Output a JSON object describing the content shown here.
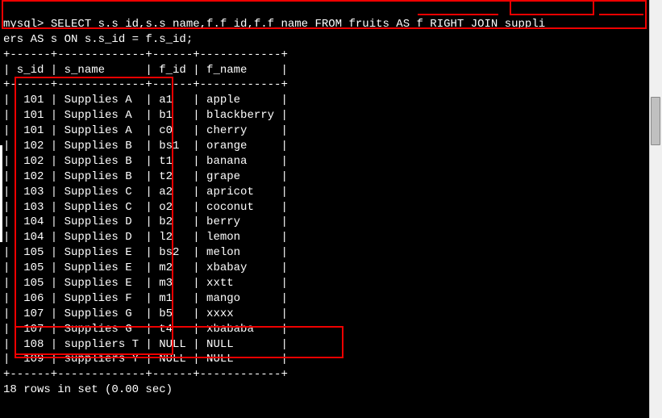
{
  "prompt": "mysql>",
  "query_line1": " SELECT s.s_id,s.s_name,f.f_id,f.f_name FROM fruits AS f RIGHT JOIN suppli",
  "query_line2": "ers AS s ON s.s_id = f.s_id;",
  "separator": "+------+-------------+------+------------+",
  "header": "| s_id | s_name      | f_id | f_name     |",
  "rows": [
    "|  101 | Supplies A  | a1   | apple      |",
    "|  101 | Supplies A  | b1   | blackberry |",
    "|  101 | Supplies A  | c0   | cherry     |",
    "|  102 | Supplies B  | bs1  | orange     |",
    "|  102 | Supplies B  | t1   | banana     |",
    "|  102 | Supplies B  | t2   | grape      |",
    "|  103 | Supplies C  | a2   | apricot    |",
    "|  103 | Supplies C  | o2   | coconut    |",
    "|  104 | Supplies D  | b2   | berry      |",
    "|  104 | Supplies D  | l2   | lemon      |",
    "|  105 | Supplies E  | bs2  | melon      |",
    "|  105 | Supplies E  | m2   | xbabay     |",
    "|  105 | Supplies E  | m3   | xxtt       |",
    "|  106 | Supplies F  | m1   | mango      |",
    "|  107 | Supplies G  | b5   | xxxx       |",
    "|  107 | Supplies G  | t4   | xbababa    |",
    "|  108 | suppliers T | NULL | NULL       |",
    "|  109 | suppliers Y | NULL | NULL       |"
  ],
  "footer": "18 rows in set (0.00 sec)",
  "chart_data": {
    "type": "table",
    "columns": [
      "s_id",
      "s_name",
      "f_id",
      "f_name"
    ],
    "data": [
      {
        "s_id": 101,
        "s_name": "Supplies A",
        "f_id": "a1",
        "f_name": "apple"
      },
      {
        "s_id": 101,
        "s_name": "Supplies A",
        "f_id": "b1",
        "f_name": "blackberry"
      },
      {
        "s_id": 101,
        "s_name": "Supplies A",
        "f_id": "c0",
        "f_name": "cherry"
      },
      {
        "s_id": 102,
        "s_name": "Supplies B",
        "f_id": "bs1",
        "f_name": "orange"
      },
      {
        "s_id": 102,
        "s_name": "Supplies B",
        "f_id": "t1",
        "f_name": "banana"
      },
      {
        "s_id": 102,
        "s_name": "Supplies B",
        "f_id": "t2",
        "f_name": "grape"
      },
      {
        "s_id": 103,
        "s_name": "Supplies C",
        "f_id": "a2",
        "f_name": "apricot"
      },
      {
        "s_id": 103,
        "s_name": "Supplies C",
        "f_id": "o2",
        "f_name": "coconut"
      },
      {
        "s_id": 104,
        "s_name": "Supplies D",
        "f_id": "b2",
        "f_name": "berry"
      },
      {
        "s_id": 104,
        "s_name": "Supplies D",
        "f_id": "l2",
        "f_name": "lemon"
      },
      {
        "s_id": 105,
        "s_name": "Supplies E",
        "f_id": "bs2",
        "f_name": "melon"
      },
      {
        "s_id": 105,
        "s_name": "Supplies E",
        "f_id": "m2",
        "f_name": "xbabay"
      },
      {
        "s_id": 105,
        "s_name": "Supplies E",
        "f_id": "m3",
        "f_name": "xxtt"
      },
      {
        "s_id": 106,
        "s_name": "Supplies F",
        "f_id": "m1",
        "f_name": "mango"
      },
      {
        "s_id": 107,
        "s_name": "Supplies G",
        "f_id": "b5",
        "f_name": "xxxx"
      },
      {
        "s_id": 107,
        "s_name": "Supplies G",
        "f_id": "t4",
        "f_name": "xbababa"
      },
      {
        "s_id": 108,
        "s_name": "suppliers T",
        "f_id": null,
        "f_name": null
      },
      {
        "s_id": 109,
        "s_name": "suppliers Y",
        "f_id": null,
        "f_name": null
      }
    ],
    "result_message": "18 rows in set (0.00 sec)"
  }
}
